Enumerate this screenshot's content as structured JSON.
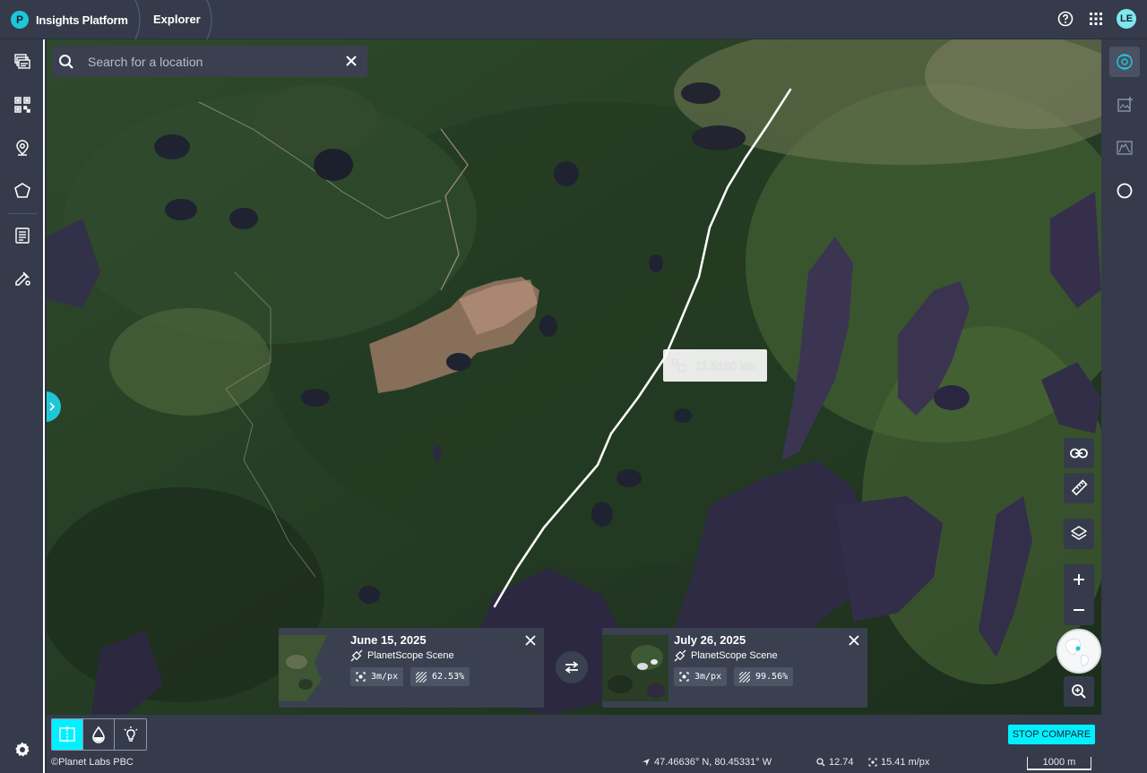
{
  "header": {
    "brand_logo_letter": "P",
    "app_name": "Insights Platform",
    "breadcrumb": "Explorer",
    "user_initials": "LE"
  },
  "search": {
    "placeholder": "Search for a location"
  },
  "measurement": {
    "label": "11.5150 km"
  },
  "compare": {
    "left_scene": {
      "date": "June 15, 2025",
      "type": "PlanetScope Scene",
      "resolution": "3m/px",
      "coverage": "62.53%"
    },
    "right_scene": {
      "date": "July 26, 2025",
      "type": "PlanetScope Scene",
      "resolution": "3m/px",
      "coverage": "99.56%"
    },
    "stop_label": "STOP COMPARE"
  },
  "status": {
    "attribution": "©Planet Labs PBC",
    "coordinates": "47.46636° N, 80.45331° W",
    "zoom": "12.74",
    "resolution": "15.41 m/px",
    "scale": "1000 m"
  },
  "colors": {
    "accent": "#00f0ff",
    "panel": "#353b4a",
    "card": "#3a4050"
  },
  "icons": {
    "left_rail": [
      "layers-stack-icon",
      "qr-grid-icon",
      "location-pin-icon",
      "polygon-icon",
      "document-list-icon",
      "brush-settings-icon"
    ],
    "right_rail": [
      "satellite-scan-icon",
      "image-add-icon",
      "chart-profile-icon",
      "contrast-icon"
    ],
    "map_controls": [
      "link-icon",
      "ruler-icon",
      "layers-icon",
      "plus-icon",
      "minus-icon",
      "globe-icon",
      "zoom-in-icon"
    ],
    "bottom": [
      "split-view-icon",
      "water-drop-icon",
      "lightbulb-icon"
    ]
  }
}
